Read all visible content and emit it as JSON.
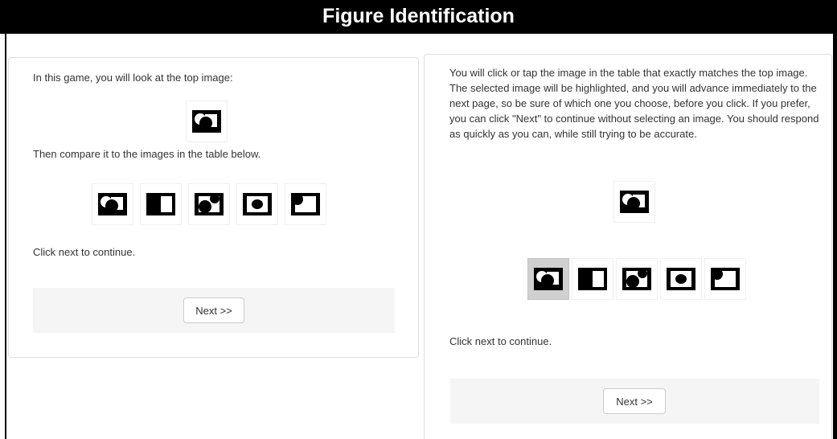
{
  "header": {
    "title": "Figure Identification"
  },
  "left_panel": {
    "intro": "In this game, you will look at the top image:",
    "compare": "Then compare it to the images in the table below.",
    "continue": "Click next to continue.",
    "next_label": "Next >>"
  },
  "right_panel": {
    "instructions": "You will click or tap the image in the table that exactly matches the top image. The selected image will be highlighted, and you will advance immediately to the next page, so be sure of which one you choose, before you click. If you prefer, you can click \"Next\" to continue without selecting an image. You should respond as quickly as you can, while still trying to be accurate.",
    "continue": "Click next to continue.",
    "next_label": "Next >>"
  },
  "figures": {
    "target": "target-figure",
    "choices": [
      "figure-choice-1",
      "figure-choice-2",
      "figure-choice-3",
      "figure-choice-4",
      "figure-choice-5"
    ],
    "highlighted_choice_index": 1
  },
  "colors": {
    "banner": "#000000",
    "highlight": "#d0d0d0",
    "footer": "#f5f5f5"
  }
}
